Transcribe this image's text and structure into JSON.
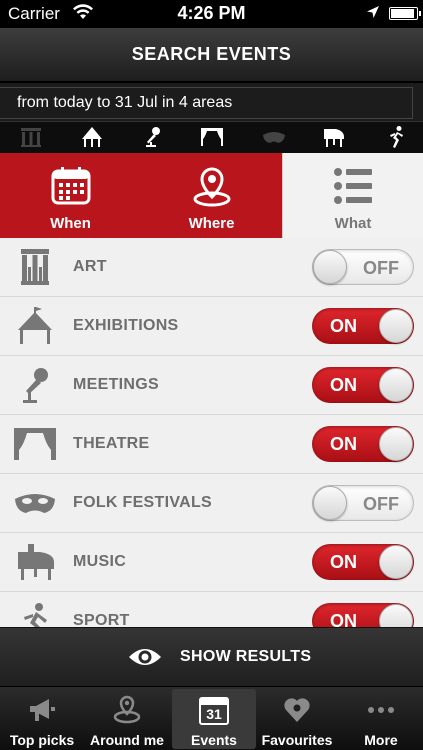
{
  "status_bar": {
    "carrier": "Carrier",
    "time": "4:26 PM"
  },
  "header": {
    "title": "SEARCH EVENTS"
  },
  "summary": {
    "text": "from today to 31 Jul in 4 areas"
  },
  "category_strip": [
    "art-icon",
    "exhibitions-icon",
    "meetings-icon",
    "theatre-icon",
    "folk-festivals-icon",
    "music-icon",
    "sport-icon"
  ],
  "tabs": [
    {
      "label": "When",
      "icon": "calendar-icon",
      "active": true
    },
    {
      "label": "Where",
      "icon": "location-pin-icon",
      "active": true
    },
    {
      "label": "What",
      "icon": "list-icon",
      "active": false
    }
  ],
  "categories": [
    {
      "label": "ART",
      "state": "OFF",
      "icon": "art-icon"
    },
    {
      "label": "EXHIBITIONS",
      "state": "ON",
      "icon": "exhibitions-icon"
    },
    {
      "label": "MEETINGS",
      "state": "ON",
      "icon": "meetings-icon"
    },
    {
      "label": "THEATRE",
      "state": "ON",
      "icon": "theatre-icon"
    },
    {
      "label": "FOLK FESTIVALS",
      "state": "OFF",
      "icon": "folk-festivals-icon"
    },
    {
      "label": "MUSIC",
      "state": "ON",
      "icon": "music-icon"
    },
    {
      "label": "SPORT",
      "state": "ON",
      "icon": "sport-icon"
    }
  ],
  "show_results": {
    "label": "SHOW RESULTS"
  },
  "tabbar": {
    "calendar_day": "31",
    "items": [
      {
        "label": "Top picks",
        "icon": "megaphone-icon"
      },
      {
        "label": "Around me",
        "icon": "around-me-icon"
      },
      {
        "label": "Events",
        "icon": "calendar-icon",
        "active": true
      },
      {
        "label": "Favourites",
        "icon": "heart-icon"
      },
      {
        "label": "More",
        "icon": "more-icon"
      }
    ]
  },
  "colors": {
    "accent": "#b8161c",
    "toggle_on": "#d11e25",
    "label_gray": "#6e6e6e"
  }
}
